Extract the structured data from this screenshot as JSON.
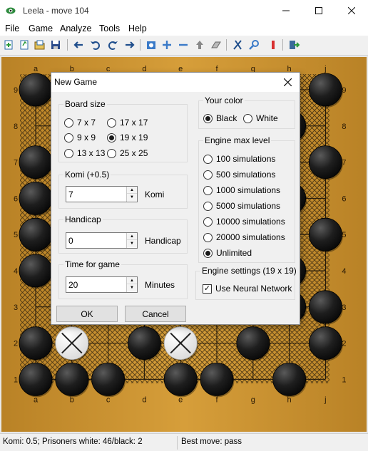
{
  "window": {
    "title": "Leela - move 104"
  },
  "menu": [
    "File",
    "Game",
    "Analyze",
    "Tools",
    "Help"
  ],
  "toolbar": {
    "icons": [
      "new-game-icon",
      "new-position-icon",
      "open-icon",
      "save-icon",
      "back-icon",
      "undo-icon",
      "redo-icon",
      "forward-icon",
      "settings-icon",
      "zoom-in-icon",
      "zoom-out-icon",
      "upload-icon",
      "eraser-icon",
      "cut-icon",
      "analyze-icon",
      "marker-icon",
      "exit-icon"
    ]
  },
  "board": {
    "letters": [
      "a",
      "b",
      "c",
      "d",
      "e",
      "f",
      "g",
      "h",
      "j"
    ],
    "numbers": [
      "9",
      "8",
      "7",
      "6",
      "5",
      "4",
      "3",
      "2",
      "1"
    ],
    "colors": {
      "wood": "#c8912d",
      "black_stone": "#1a1a1a",
      "white_stone": "#ffffff",
      "territory": "#3a2a10"
    },
    "stones": [
      {
        "col": "a",
        "row": "9",
        "color": "black"
      },
      {
        "col": "j",
        "row": "9",
        "color": "black"
      },
      {
        "col": "h",
        "row": "8",
        "color": "black"
      },
      {
        "col": "a",
        "row": "7",
        "color": "black"
      },
      {
        "col": "j",
        "row": "7",
        "color": "black"
      },
      {
        "col": "a",
        "row": "6",
        "color": "black"
      },
      {
        "col": "h",
        "row": "6",
        "color": "black"
      },
      {
        "col": "a",
        "row": "5",
        "color": "black"
      },
      {
        "col": "j",
        "row": "5",
        "color": "black"
      },
      {
        "col": "a",
        "row": "4",
        "color": "black"
      },
      {
        "col": "h",
        "row": "4",
        "color": "black"
      },
      {
        "col": "h",
        "row": "3",
        "color": "black"
      },
      {
        "col": "j",
        "row": "3",
        "color": "black"
      },
      {
        "col": "a",
        "row": "2",
        "color": "black"
      },
      {
        "col": "b",
        "row": "2",
        "color": "white",
        "dead": true
      },
      {
        "col": "d",
        "row": "2",
        "color": "black"
      },
      {
        "col": "e",
        "row": "2",
        "color": "white",
        "dead": true
      },
      {
        "col": "g",
        "row": "2",
        "color": "black"
      },
      {
        "col": "j",
        "row": "2",
        "color": "black"
      },
      {
        "col": "a",
        "row": "1",
        "color": "black"
      },
      {
        "col": "b",
        "row": "1",
        "color": "black"
      },
      {
        "col": "c",
        "row": "1",
        "color": "black"
      },
      {
        "col": "e",
        "row": "1",
        "color": "black"
      },
      {
        "col": "f",
        "row": "1",
        "color": "black"
      },
      {
        "col": "h",
        "row": "1",
        "color": "black"
      }
    ]
  },
  "dialog": {
    "title": "New Game",
    "board_size": {
      "label": "Board size",
      "options": [
        "7 x 7",
        "17 x 17",
        "9 x 9",
        "19 x 19",
        "13 x 13",
        "25 x 25"
      ],
      "selected": "19 x 19"
    },
    "komi": {
      "label": "Komi (+0.5)",
      "value": "7",
      "unit": "Komi"
    },
    "handicap": {
      "label": "Handicap",
      "value": "0",
      "unit": "Handicap"
    },
    "time": {
      "label": "Time for game",
      "value": "20",
      "unit": "Minutes"
    },
    "color": {
      "label": "Your color",
      "options": [
        "Black",
        "White"
      ],
      "selected": "Black"
    },
    "engine_level": {
      "label": "Engine max level",
      "options": [
        "100 simulations",
        "500 simulations",
        "1000 simulations",
        "5000 simulations",
        "10000 simulations",
        "20000 simulations",
        "Unlimited"
      ],
      "selected": "Unlimited"
    },
    "engine_settings": {
      "label": "Engine settings (19 x 19)",
      "neural_network_label": "Use Neural Network",
      "neural_network_checked": true
    },
    "ok_label": "OK",
    "cancel_label": "Cancel"
  },
  "status": {
    "left": "Komi: 0.5; Prisoners white: 46/black: 2",
    "right": "Best move: pass"
  }
}
